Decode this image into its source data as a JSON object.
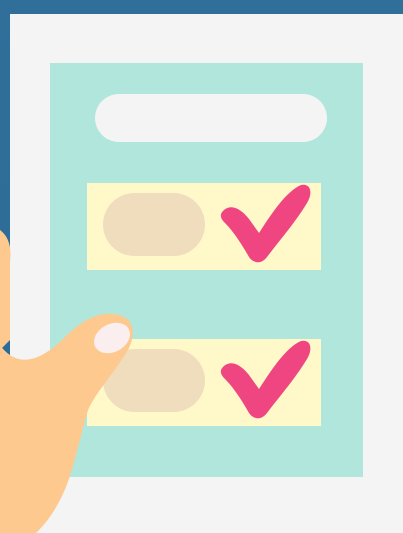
{
  "illustration": {
    "background_color": "#2f6f9a",
    "paper_color": "#f4f4f4",
    "card_color": "#b1e6dc",
    "title_placeholder_color": "#f4f4f4",
    "item_background_color": "#fff9c9",
    "item_placeholder_color": "#efddbd",
    "check_color": "#ef4682",
    "hand_color": "#fdc98e",
    "nail_color": "#fbeeee"
  },
  "checklist": {
    "items": [
      {
        "checked": true,
        "icon": "checkmark-icon"
      },
      {
        "checked": true,
        "icon": "checkmark-icon"
      }
    ]
  }
}
